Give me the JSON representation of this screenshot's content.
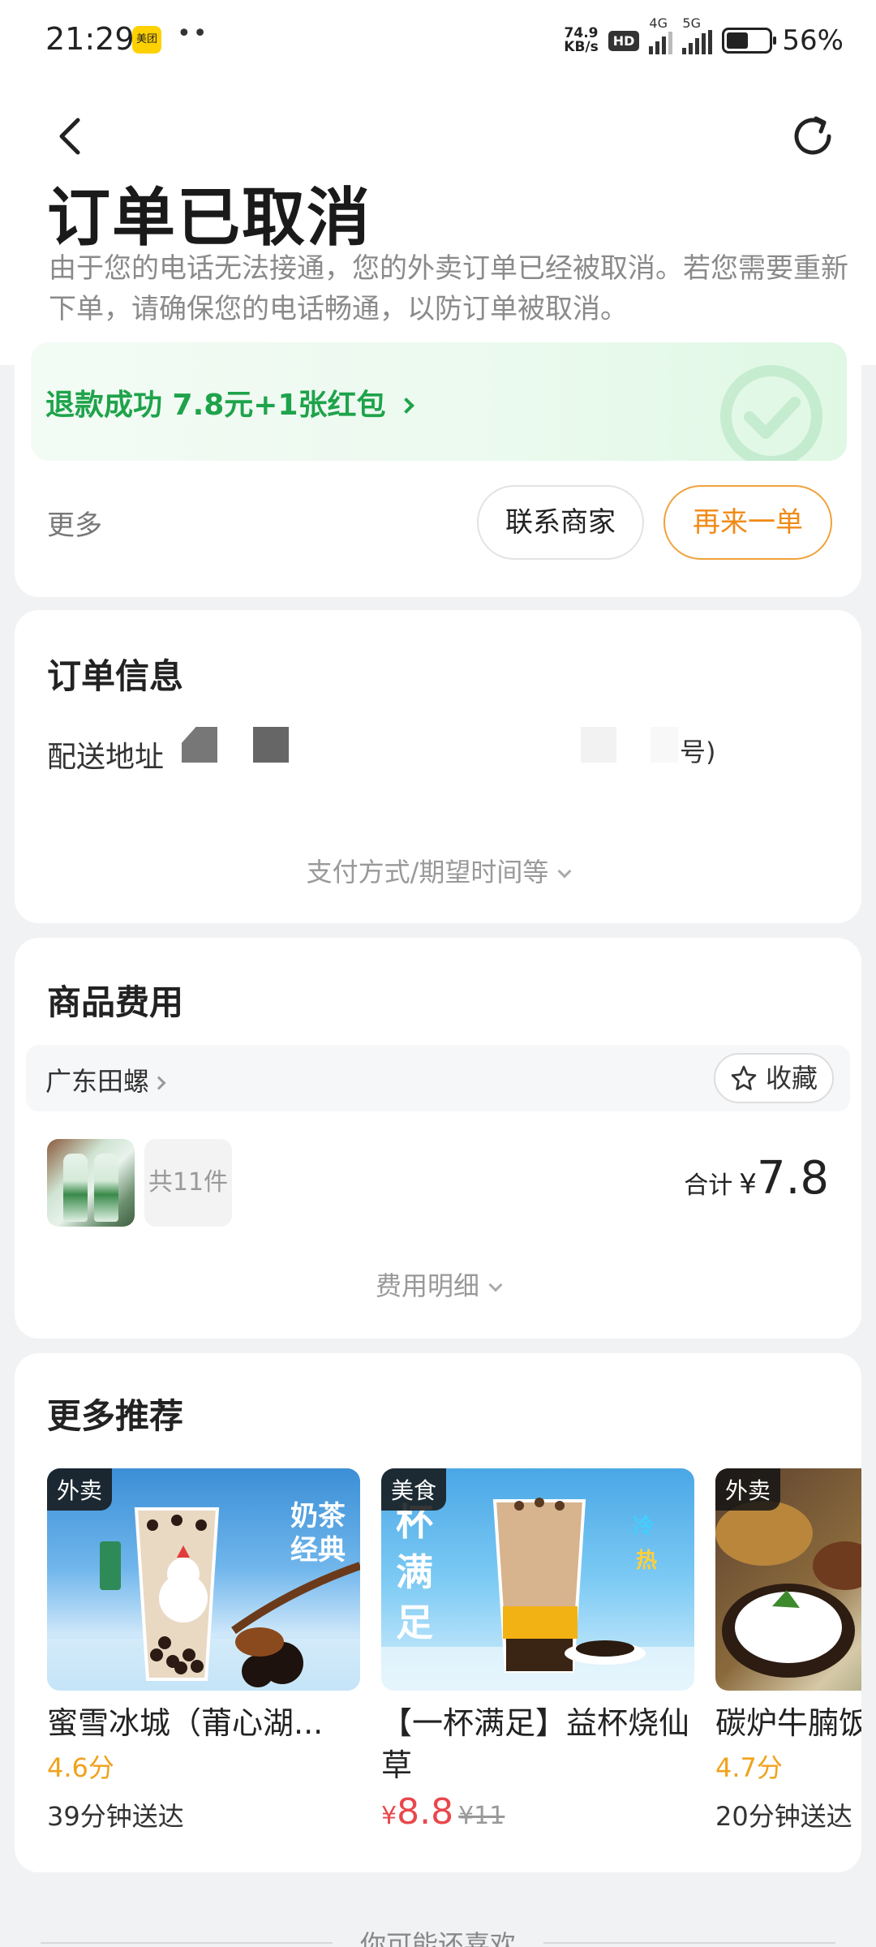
{
  "status_bar": {
    "time": "21:29",
    "app_badge": "美团",
    "net_speed_value": "74.9",
    "net_speed_unit": "KB/s",
    "hd_label": "HD",
    "net_4g": "4G",
    "net_5g": "5G",
    "battery_percent": "56%",
    "battery_level": 0.56
  },
  "header": {
    "title": "订单已取消",
    "description": "由于您的电话无法接通，您的外卖订单已经被取消。若您需要重新下单，请确保您的电话畅通，以防订单被取消。",
    "refund_text": "退款成功 7.8元+1张红包",
    "more_label": "更多",
    "contact_button": "联系商家",
    "reorder_button": "再来一单"
  },
  "order_info": {
    "title": "订单信息",
    "address_label": "配送地址",
    "address_tail": "号)",
    "expand_label": "支付方式/期望时间等"
  },
  "goods": {
    "title": "商品费用",
    "shop_name": "广东田螺",
    "favorite_label": "收藏",
    "count_label": "共11件",
    "total_label": "合计",
    "currency": "¥",
    "total_value": "7.8",
    "detail_label": "费用明细"
  },
  "recommend": {
    "title": "更多推荐",
    "items": [
      {
        "tag": "外卖",
        "name": "蜜雪冰城（莆心湖...",
        "score": "4.6分",
        "time": "39分钟送达",
        "img_text": "奶茶经典"
      },
      {
        "tag": "美食",
        "name": "【一杯满足】益杯烧仙草",
        "price_currency": "¥",
        "price": "8.8",
        "original_price": "¥11",
        "img_text": "一杯满足"
      },
      {
        "tag": "外卖",
        "name": "碳炉牛腩饭",
        "score": "4.7分",
        "time": "20分钟送达"
      }
    ]
  },
  "footer": {
    "hint": "你可能还喜欢"
  },
  "colors": {
    "refund_green": "#1ea34a",
    "reorder_orange": "#f08a16",
    "score_orange": "#f0a21c",
    "price_red": "#e8474c"
  }
}
